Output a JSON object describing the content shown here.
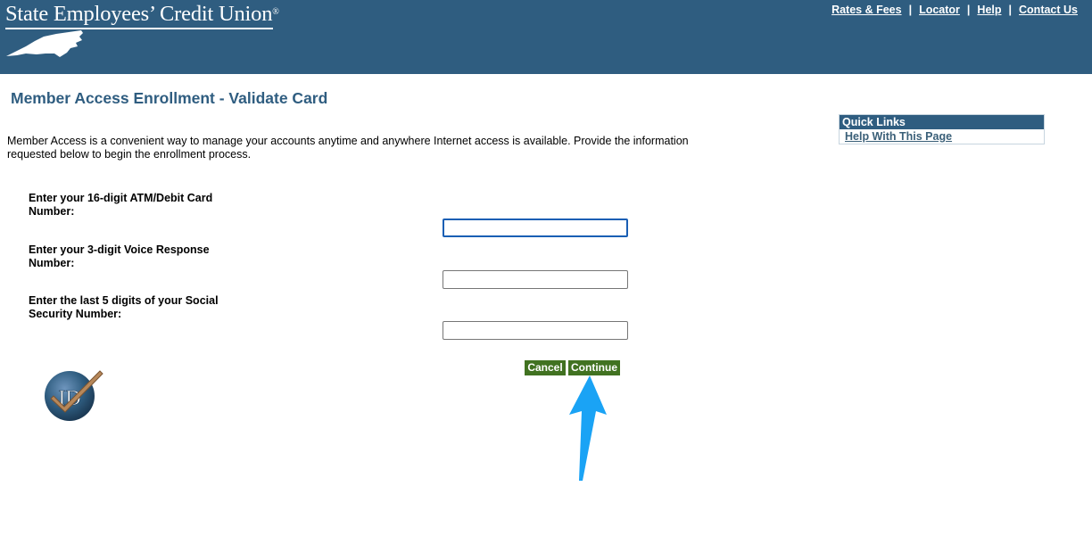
{
  "header": {
    "logo_text": "State Employees’ Credit Union",
    "logo_reg": "®",
    "nav": [
      {
        "label": "Rates & Fees"
      },
      {
        "label": "Locator"
      },
      {
        "label": "Help"
      },
      {
        "label": "Contact Us"
      }
    ],
    "nav_separator": "|"
  },
  "page": {
    "title": "Member Access Enrollment - Validate Card",
    "intro": "Member Access is a convenient way to manage your accounts anytime and anywhere Internet access is available. Provide the information requested below to begin the enrollment process."
  },
  "quick_links": {
    "heading": "Quick Links",
    "items": [
      {
        "label": "Help With This Page"
      }
    ]
  },
  "form": {
    "fields": [
      {
        "label": "Enter your 16-digit ATM/Debit Card Number:",
        "value": ""
      },
      {
        "label": "Enter your 3-digit Voice Response Number:",
        "value": ""
      },
      {
        "label": "Enter the last 5 digits of your Social Security Number:",
        "value": ""
      }
    ],
    "cancel_label": "Cancel",
    "continue_label": "Continue"
  },
  "badge": {
    "text": "ID"
  },
  "colors": {
    "header_bg": "#2f5d80",
    "button_bg": "#417221",
    "annotation_arrow": "#1aa3f5"
  },
  "icons": [
    "north-carolina-state-icon",
    "id-checkmark-icon",
    "annotation-arrow-icon"
  ]
}
